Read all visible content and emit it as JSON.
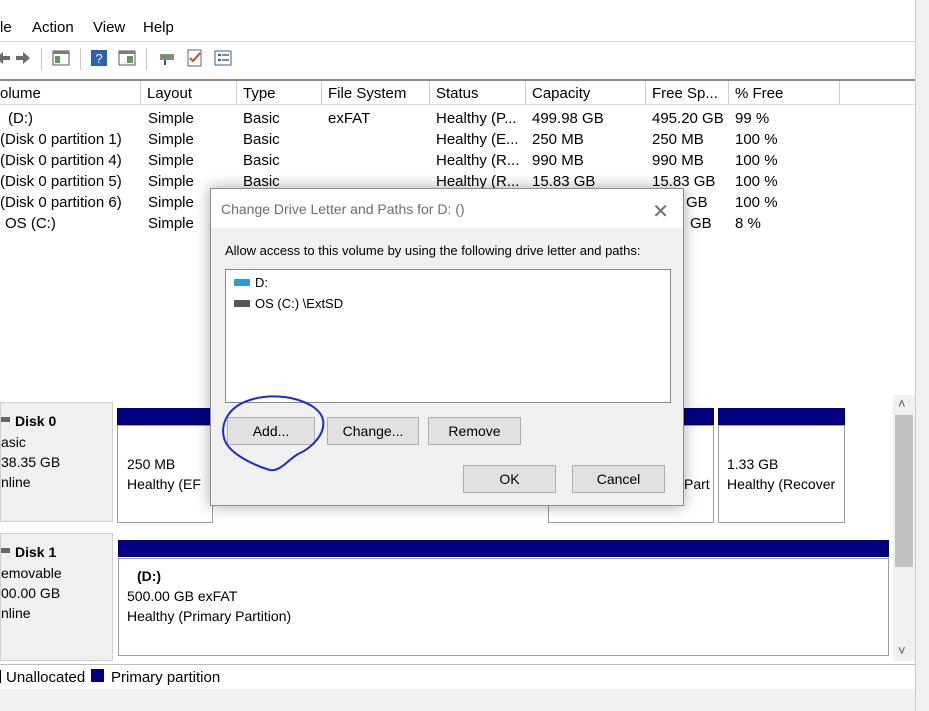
{
  "menu": {
    "items": [
      "le",
      "Action",
      "View",
      "Help"
    ]
  },
  "toolbar": {
    "icons": [
      "back-icon",
      "forward-icon",
      "console-tree-icon",
      "help-icon",
      "properties-icon",
      "connect-drive-icon",
      "checklist-icon",
      "settings-list-icon"
    ]
  },
  "volume_list": {
    "columns": [
      "olume",
      "Layout",
      "Type",
      "File System",
      "Status",
      "Capacity",
      "Free Sp...",
      "% Free"
    ],
    "rows": [
      [
        "(D:)",
        "Simple",
        "Basic",
        "exFAT",
        "Healthy (P...",
        "499.98 GB",
        "495.20 GB",
        "99 %"
      ],
      [
        "(Disk 0 partition 1)",
        "Simple",
        "Basic",
        "",
        "Healthy (E...",
        "250 MB",
        "250 MB",
        "100 %"
      ],
      [
        "(Disk 0 partition 4)",
        "Simple",
        "Basic",
        "",
        "Healthy (R...",
        "990 MB",
        "990 MB",
        "100 %"
      ],
      [
        "(Disk 0 partition 5)",
        "Simple",
        "Basic",
        "",
        "Healthy (R...",
        "15.83 GB",
        "15.83 GB",
        "100 %"
      ],
      [
        "(Disk 0 partition 6)",
        "Simple",
        "",
        "",
        "",
        "",
        "GB",
        "100 %"
      ],
      [
        "OS (C:)",
        "Simple",
        "",
        "",
        "",
        "",
        "GB",
        "8 %"
      ]
    ]
  },
  "disks": {
    "disk0": {
      "name": "Disk 0",
      "type": "asic",
      "size": "38.35 GB",
      "state": "nline",
      "partitions": [
        {
          "size": "250 MB",
          "status": "Healthy (EF"
        },
        {
          "size": "",
          "status": "Part"
        },
        {
          "size": "1.33 GB",
          "status": "Healthy (Recover"
        }
      ]
    },
    "disk1": {
      "name": "Disk 1",
      "type": "emovable",
      "size": "00.00 GB",
      "state": "nline",
      "partition": {
        "name": "(D:)",
        "size": "500.00 GB exFAT",
        "status": "Healthy (Primary Partition)"
      }
    }
  },
  "legend": {
    "unallocated": "Unallocated",
    "primary": "Primary partition"
  },
  "dialog": {
    "title": "Change Drive Letter and Paths for D: ()",
    "close": "✕",
    "prompt": "Allow access to this volume by using the following drive letter and paths:",
    "paths": [
      "D:",
      "OS (C:) \\ExtSD"
    ],
    "buttons": {
      "add": "Add...",
      "change": "Change...",
      "remove": "Remove",
      "ok": "OK",
      "cancel": "Cancel"
    }
  },
  "scroll": {
    "up": "˄",
    "down": "˅"
  },
  "colors": {
    "primary_partition": "#000080",
    "annotation": "#1a2bd6",
    "drive_icon": "#2a9bd6"
  }
}
